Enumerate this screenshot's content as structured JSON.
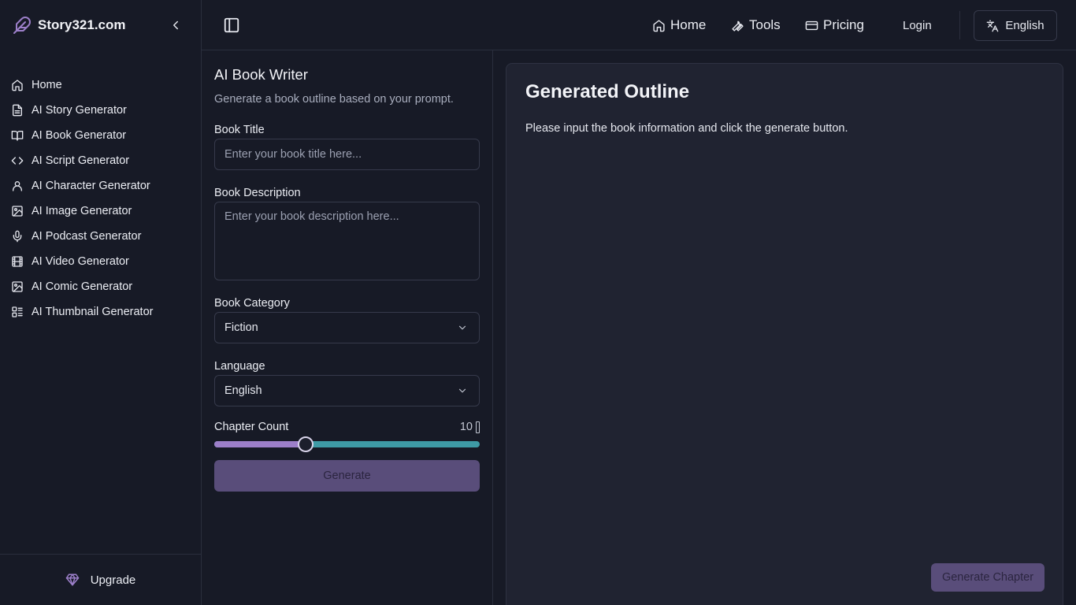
{
  "brand": {
    "name": "Story321.com",
    "icon": "feather-icon"
  },
  "sidebar": {
    "items": [
      {
        "label": "Home",
        "icon": "home-icon"
      },
      {
        "label": "AI Story Generator",
        "icon": "document-icon"
      },
      {
        "label": "AI Book Generator",
        "icon": "book-icon"
      },
      {
        "label": "AI Script Generator",
        "icon": "code-icon"
      },
      {
        "label": "AI Character Generator",
        "icon": "user-icon"
      },
      {
        "label": "AI Image Generator",
        "icon": "image-icon"
      },
      {
        "label": "AI Podcast Generator",
        "icon": "microphone-icon"
      },
      {
        "label": "AI Video Generator",
        "icon": "film-icon"
      },
      {
        "label": "AI Comic Generator",
        "icon": "image-icon"
      },
      {
        "label": "AI Thumbnail Generator",
        "icon": "thumbnail-icon"
      }
    ],
    "upgrade_label": "Upgrade"
  },
  "topbar": {
    "home": "Home",
    "tools": "Tools",
    "pricing": "Pricing",
    "login": "Login",
    "language": "English"
  },
  "form": {
    "title": "AI Book Writer",
    "subtitle": "Generate a book outline based on your prompt.",
    "book_title_label": "Book Title",
    "book_title_placeholder": "Enter your book title here...",
    "book_title_value": "",
    "description_label": "Book Description",
    "description_placeholder": "Enter your book description here...",
    "description_value": "",
    "category_label": "Book Category",
    "category_value": "Fiction",
    "language_label": "Language",
    "language_value": "English",
    "chapter_label": "Chapter Count",
    "chapter_value": "10",
    "chapter_fraction": 0.345,
    "generate_label": "Generate"
  },
  "output": {
    "title": "Generated Outline",
    "message": "Please input the book information and click the generate button.",
    "generate_chapter_label": "Generate Chapter"
  },
  "colors": {
    "background": "#171a26",
    "panel": "#202331",
    "accent": "#594d7a",
    "slider_fill": "#9c7fc9",
    "slider_track": "#3e9aa5",
    "brand_icon": "#9c7fc9"
  }
}
